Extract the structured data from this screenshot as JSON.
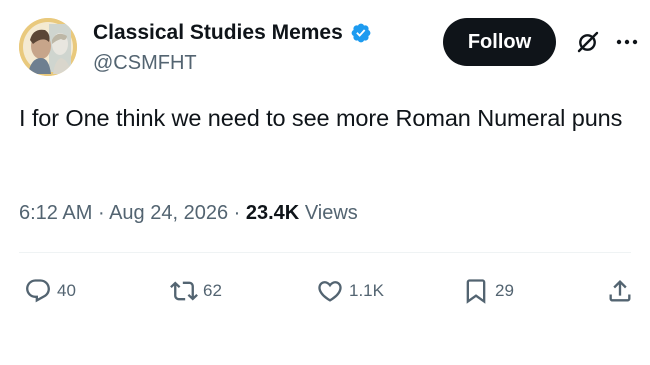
{
  "author": {
    "display_name": "Classical Studies Memes",
    "handle": "@CSMFHT",
    "verified_icon": "verified-badge-icon",
    "avatar": "avatar-image"
  },
  "header": {
    "follow_label": "Follow",
    "grok_icon": "grok-icon",
    "more_icon": "more-options-icon"
  },
  "tweet": {
    "text": "I for One think we need to see more Roman Numeral puns",
    "time": "6:12 AM",
    "separator": "·",
    "date": "Aug 24, 2026",
    "views_count": "23.4K",
    "views_label": "Views"
  },
  "actions": {
    "replies": "40",
    "reposts": "62",
    "likes": "1.1K",
    "bookmarks": "29"
  },
  "colors": {
    "text_primary": "#0f1419",
    "text_secondary": "#536471",
    "verified_blue": "#1d9bf0",
    "follow_bg": "#0f1419",
    "avatar_ring": "#e9c97d"
  }
}
